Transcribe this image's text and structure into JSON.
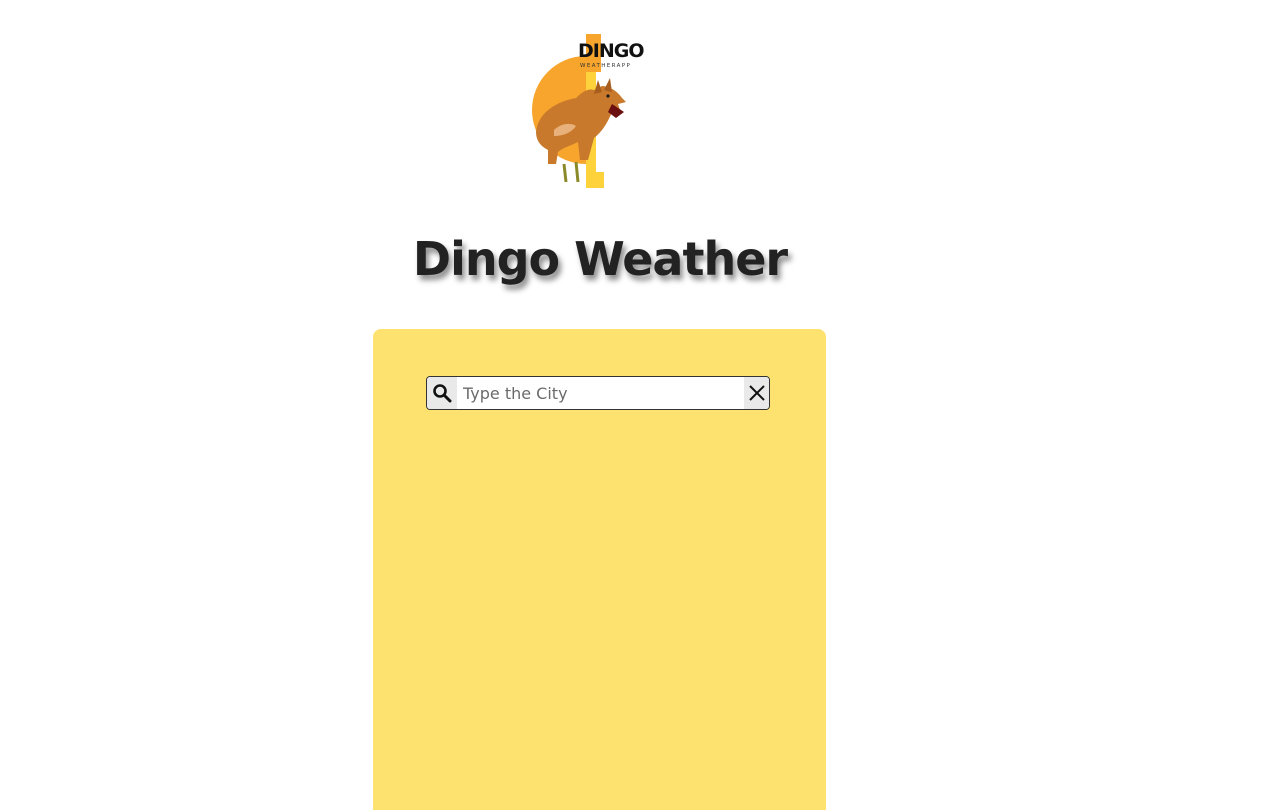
{
  "logo": {
    "word": "DINGO",
    "subtitle": "WEATHERAPP",
    "icon": "dingo-logo-image"
  },
  "header": {
    "title": "Dingo Weather"
  },
  "search": {
    "placeholder": "Type the City",
    "value": "",
    "search_icon": "search-icon",
    "clear_icon": "close-icon"
  },
  "colors": {
    "panel": "#fee26f",
    "logo_orange": "#f7a52c",
    "logo_yellow": "#fdd23a"
  }
}
